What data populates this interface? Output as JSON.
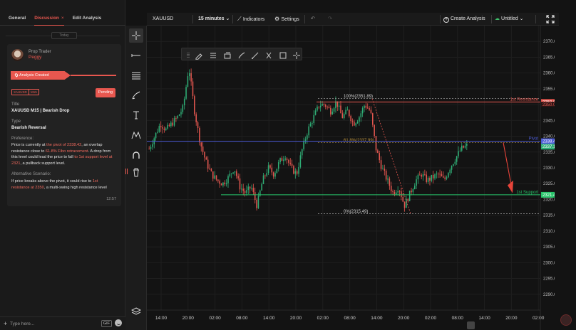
{
  "left_panel": {
    "tabs": [
      {
        "label": "General"
      },
      {
        "label": "Discussion",
        "close": "×"
      },
      {
        "label": "Edit Analysis"
      }
    ],
    "today": "Today",
    "card": {
      "author_role": "Prop Trader",
      "author_name": "Peggy",
      "banner": "Analysis Created",
      "tags": [
        "XAUUSD",
        "M15"
      ],
      "status": "Pending",
      "title_label": "Title",
      "title": "XAUUSD M15 | Bearish Drop",
      "type_label": "Type",
      "type": "Bearish Reversal",
      "preference_label": "Preference:",
      "preference": [
        {
          "t": "Price is currently at ",
          "h": false
        },
        {
          "t": "the pivot of 2338.42",
          "h": true
        },
        {
          "t": ", an overlap resistance close to ",
          "h": false
        },
        {
          "t": "61.8% Fibo retracement",
          "h": true
        },
        {
          "t": ". A drop from this level could lead the price to fall ",
          "h": false
        },
        {
          "t": "to 1st support level at 2321",
          "h": true
        },
        {
          "t": ", a pullback support level.",
          "h": false
        }
      ],
      "alt_label": "Alternative Scenario:",
      "alternative": [
        {
          "t": "If price breaks above the pivot, it could rise to ",
          "h": false
        },
        {
          "t": "1st resistance at 2350",
          "h": true
        },
        {
          "t": ", a multi-swing high resistance level",
          "h": false
        }
      ],
      "time": "12:57"
    },
    "composer": {
      "placeholder": "Type here...",
      "gif": "GIF"
    }
  },
  "header": {
    "symbol": "XAUUSD",
    "interval": "15 minutes",
    "indicators": "Indicators",
    "settings": "Settings",
    "create": "Create Analysis",
    "untitled": "Untitled"
  },
  "colors": {
    "accent": "#e8574f",
    "resistance": "#e8574f",
    "support": "#27c56a",
    "pivot": "#4c5bd6",
    "fib": "#aaaaaa",
    "bull": "#2fae76",
    "bear": "#e2564f"
  },
  "chart_data": {
    "type": "candlestick",
    "symbol": "XAUUSD",
    "ylim": [
      2285,
      2375
    ],
    "y_ticks": [
      2290,
      2295,
      2300,
      2305,
      2310,
      2315,
      2320,
      2325,
      2330,
      2335,
      2340,
      2345,
      2350,
      2355,
      2360,
      2365,
      2370
    ],
    "x_ticks": [
      "14:00",
      "20:00",
      "02:00",
      "08:00",
      "14:00",
      "20:00",
      "02:00",
      "08:00",
      "14:00",
      "20:00",
      "02:00",
      "08:00",
      "14:00",
      "20:00",
      "02:00"
    ],
    "levels": [
      {
        "name": "1st Resistance",
        "value": 2350.85,
        "label": "2350.85",
        "color_key": "resistance"
      },
      {
        "name": "Pivot",
        "value": 2338.42,
        "label": "2338.42",
        "color_key": "pivot"
      },
      {
        "name": "1st Support",
        "value": 2321.47,
        "label": "2321.47",
        "color_key": "support"
      }
    ],
    "last_price": {
      "value": 2337.15,
      "label": "2337.15"
    },
    "fib": [
      {
        "pct": "100",
        "label": "100%(2351.89)",
        "value": 2351.89
      },
      {
        "pct": "61.8",
        "label": "61.8%(2337.99)",
        "value": 2337.99
      },
      {
        "pct": "0",
        "label": "0%(2315.49)",
        "value": 2315.49
      }
    ],
    "extra_right_label": "2350.00",
    "path": [
      2336,
      2340,
      2344,
      2342,
      2344,
      2346,
      2349,
      2362,
      2348,
      2338,
      2332,
      2328,
      2326,
      2325,
      2327,
      2330,
      2324,
      2322,
      2324,
      2318,
      2326,
      2330,
      2328,
      2332,
      2334,
      2330,
      2328,
      2336,
      2342,
      2346,
      2350,
      2350,
      2348,
      2351,
      2346,
      2348,
      2344,
      2346,
      2350,
      2348,
      2336,
      2330,
      2326,
      2322,
      2324,
      2318,
      2322,
      2326,
      2328,
      2326,
      2327,
      2328,
      2326,
      2330,
      2333,
      2336,
      2337
    ]
  }
}
